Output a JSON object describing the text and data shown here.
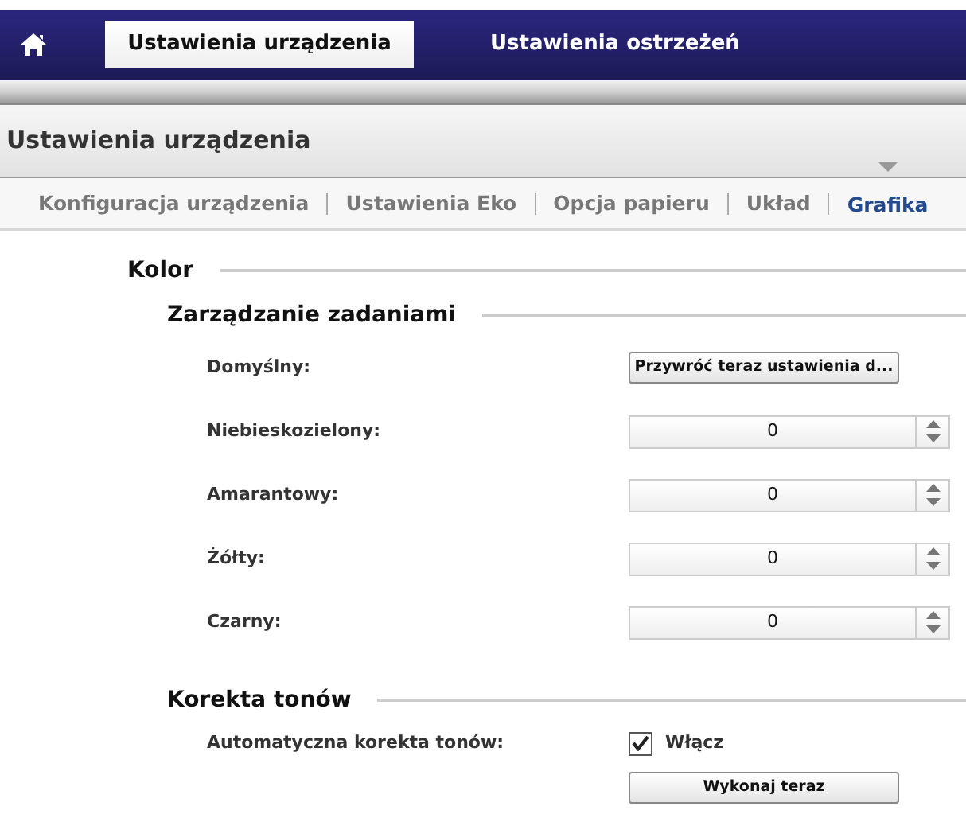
{
  "nav_tabs": [
    {
      "label": "Ustawienia urządzenia",
      "selected": true
    },
    {
      "label": "Ustawienia ostrzeżeń",
      "selected": false
    }
  ],
  "panel_title": "Ustawienia urządzenia",
  "sub_tabs": [
    {
      "label": "Konfiguracja urządzenia",
      "selected": false
    },
    {
      "label": "Ustawienia Eko",
      "selected": false
    },
    {
      "label": "Opcja papieru",
      "selected": false
    },
    {
      "label": "Układ",
      "selected": false
    },
    {
      "label": "Grafika",
      "selected": true
    }
  ],
  "section": {
    "title": "Kolor",
    "groups": [
      {
        "title": "Zarządzanie zadaniami",
        "rows": [
          {
            "kind": "button",
            "label": "Domyślny:",
            "button": "Przywróć teraz ustawienia d..."
          },
          {
            "kind": "spinner",
            "label": "Niebieskozielony:",
            "value": "0"
          },
          {
            "kind": "spinner",
            "label": "Amarantowy:",
            "value": "0"
          },
          {
            "kind": "spinner",
            "label": "Żółty:",
            "value": "0"
          },
          {
            "kind": "spinner",
            "label": "Czarny:",
            "value": "0"
          }
        ]
      },
      {
        "title": "Korekta tonów",
        "rows": [
          {
            "kind": "checkbox",
            "label": "Automatyczna korekta tonów:",
            "option": "Włącz",
            "checked": true
          },
          {
            "kind": "button",
            "button": "Wykonaj teraz"
          }
        ]
      }
    ]
  }
}
